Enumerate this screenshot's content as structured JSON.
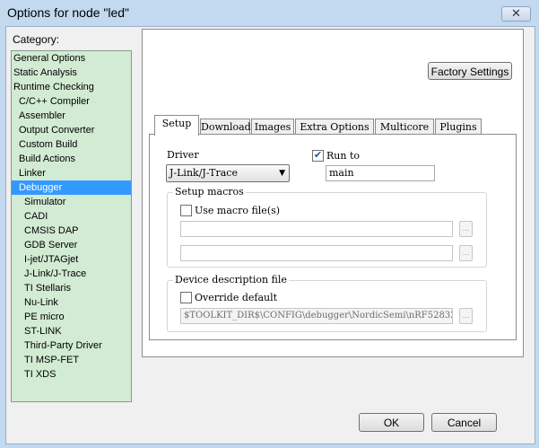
{
  "window": {
    "title": "Options for node \"led\"",
    "close_glyph": "✕"
  },
  "category": {
    "label": "Category:",
    "items": [
      {
        "label": "General Options",
        "level": 1
      },
      {
        "label": "Static Analysis",
        "level": 1
      },
      {
        "label": "Runtime Checking",
        "level": 1
      },
      {
        "label": "C/C++ Compiler",
        "level": 2
      },
      {
        "label": "Assembler",
        "level": 2
      },
      {
        "label": "Output Converter",
        "level": 2
      },
      {
        "label": "Custom Build",
        "level": 2
      },
      {
        "label": "Build Actions",
        "level": 2
      },
      {
        "label": "Linker",
        "level": 2
      },
      {
        "label": "Debugger",
        "level": 2,
        "selected": true
      },
      {
        "label": "Simulator",
        "level": 3
      },
      {
        "label": "CADI",
        "level": 3
      },
      {
        "label": "CMSIS DAP",
        "level": 3
      },
      {
        "label": "GDB Server",
        "level": 3
      },
      {
        "label": "I-jet/JTAGjet",
        "level": 3
      },
      {
        "label": "J-Link/J-Trace",
        "level": 3
      },
      {
        "label": "TI Stellaris",
        "level": 3
      },
      {
        "label": "Nu-Link",
        "level": 3
      },
      {
        "label": "PE micro",
        "level": 3
      },
      {
        "label": "ST-LINK",
        "level": 3
      },
      {
        "label": "Third-Party Driver",
        "level": 3
      },
      {
        "label": "TI MSP-FET",
        "level": 3
      },
      {
        "label": "TI XDS",
        "level": 3
      }
    ]
  },
  "factory_settings": "Factory Settings",
  "tabs": [
    "Setup",
    "Download",
    "Images",
    "Extra Options",
    "Multicore",
    "Plugins"
  ],
  "active_tab": "Setup",
  "setup": {
    "driver_label": "Driver",
    "driver_value": "J-Link/J-Trace",
    "run_to_label": "Run to",
    "run_to_checked": true,
    "run_to_value": "main",
    "setup_macros_label": "Setup macros",
    "use_macro_label": "Use macro file(s)",
    "use_macro_checked": false,
    "macro_file_1": "",
    "macro_file_2": "",
    "device_desc_label": "Device description file",
    "override_label": "Override default",
    "override_checked": false,
    "device_path": "$TOOLKIT_DIR$\\CONFIG\\debugger\\NordicSemi\\nRF52832_",
    "browse_glyph": "..."
  },
  "buttons": {
    "ok": "OK",
    "cancel": "Cancel"
  },
  "icons": {
    "checkbox_checked": "checkmark-icon",
    "dropdown": "chevron-down-icon",
    "close": "close-icon"
  }
}
